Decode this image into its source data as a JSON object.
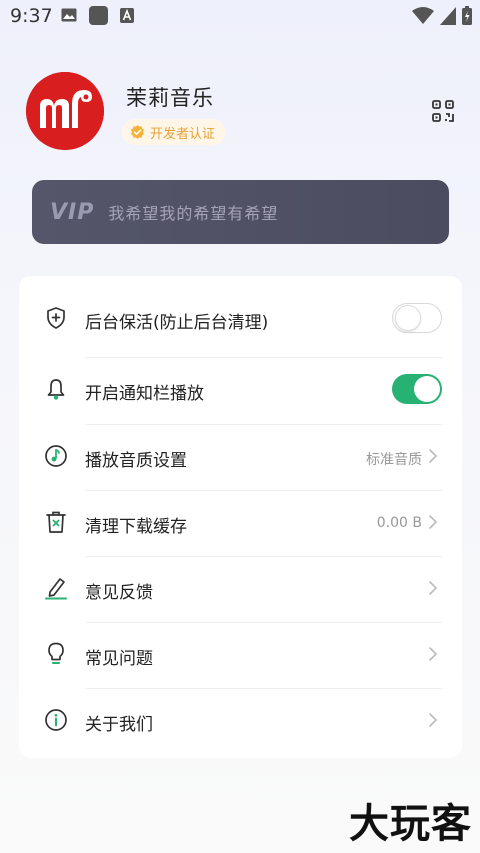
{
  "status_bar": {
    "time": "9:37",
    "left_icons": [
      "image-icon",
      "app-square-icon",
      "a-notification-icon"
    ],
    "right_icons": [
      "wifi-icon",
      "signal-icon",
      "battery-icon"
    ]
  },
  "profile": {
    "app_name": "茉莉音乐",
    "badge_label": "开发者认证",
    "badge_icon": "verified-icon",
    "avatar_letter": "m",
    "avatar_color": "#d81e1e",
    "qr_icon": "qr-code-icon"
  },
  "vip": {
    "logo": "VIP",
    "text": "我希望我的希望有希望"
  },
  "settings": [
    {
      "label": "后台保活(防止后台清理)",
      "icon": "shield-plus-icon",
      "control": "toggle",
      "on": false
    },
    {
      "label": "开启通知栏播放",
      "icon": "bell-icon",
      "control": "toggle",
      "on": true
    },
    {
      "label": "播放音质设置",
      "icon": "music-note-icon",
      "control": "chevron",
      "value": "标准音质"
    },
    {
      "label": "清理下载缓存",
      "icon": "trash-icon",
      "control": "chevron",
      "value": "0.00 B"
    },
    {
      "label": "意见反馈",
      "icon": "pencil-icon",
      "control": "chevron",
      "value": ""
    },
    {
      "label": "常见问题",
      "icon": "lightbulb-icon",
      "control": "chevron",
      "value": ""
    },
    {
      "label": "关于我们",
      "icon": "info-icon",
      "control": "chevron",
      "value": ""
    }
  ],
  "colors": {
    "accent_green": "#27b273",
    "vip_card": "#4e4f62",
    "badge_gold": "#e3a33a"
  },
  "watermark": "大玩客"
}
